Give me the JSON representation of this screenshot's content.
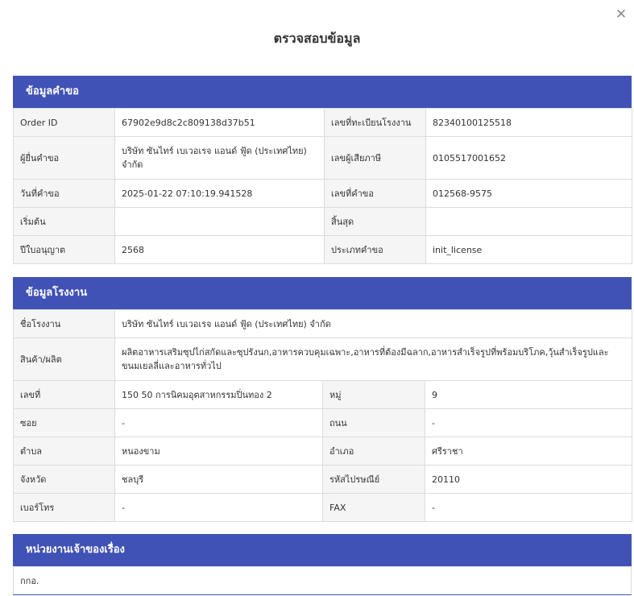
{
  "modal": {
    "title": "ตรวจสอบข้อมูล",
    "close_glyph": "✕"
  },
  "request_info": {
    "header": "ข้อมูลคำขอ",
    "rows": [
      {
        "l1": "Order ID",
        "v1": "67902e9d8c2c809138d37b51",
        "l2": "เลขที่ทะเบียนโรงงาน",
        "v2": "82340100125518"
      },
      {
        "l1": "ผู้ยื่นคำขอ",
        "v1": "บริษัท ซันไทร์ เบเวอเรจ แอนด์ ฟู้ด (ประเทศไทย) จำกัด",
        "l2": "เลขผู้เสียภาษี",
        "v2": "0105517001652"
      },
      {
        "l1": "วันที่คำขอ",
        "v1": "2025-01-22 07:10:19.941528",
        "l2": "เลขที่คำขอ",
        "v2": "012568-9575"
      },
      {
        "l1": "เริ่มต้น",
        "v1": "",
        "l2": "สิ้นสุด",
        "v2": ""
      },
      {
        "l1": "ปีใบอนุญาต",
        "v1": "2568",
        "l2": "ประเภทคำขอ",
        "v2": "init_license"
      }
    ]
  },
  "factory_info": {
    "header": "ข้อมูลโรงงาน",
    "name_label": "ชื่อโรงงาน",
    "name_value": "บริษัท ซันไทร์ เบเวอเรจ แอนด์ ฟู้ด (ประเทศไทย) จำกัด",
    "product_label": "สินค้า/ผลิต",
    "product_value": "ผลิตอาหารเสริมซุปไก่สกัดและซุปรังนก,อาหารควบคุมเฉพาะ,อาหารที่ต้องมีฉลาก,อาหารสำเร็จรูปที่พร้อมบริโภค,วุ้นสำเร็จรูปและขนมเยลลี่และอาหารทั่วไป",
    "rows": [
      {
        "l1": "เลขที่",
        "v1": "150 50 การนิคมอุตสาหกรรมปิ่นทอง 2",
        "l2": "หมู่",
        "v2": "9"
      },
      {
        "l1": "ซอย",
        "v1": "-",
        "l2": "ถนน",
        "v2": "-"
      },
      {
        "l1": "ตำบล",
        "v1": "หนองขาม",
        "l2": "อำเภอ",
        "v2": "ศรีราชา"
      },
      {
        "l1": "จังหวัด",
        "v1": "ชลบุรี",
        "l2": "รหัสไปรษณีย์",
        "v2": "20110"
      },
      {
        "l1": "เบอร์โทร",
        "v1": "-",
        "l2": "FAX",
        "v2": "-"
      }
    ]
  },
  "agency_info": {
    "header": "หน่วยงานเจ้าของเรื่อง",
    "value": "กกอ."
  },
  "colors": {
    "header_bg": "#4052b5",
    "label_bg": "#f5f5f5",
    "border": "#dcdcdc"
  }
}
